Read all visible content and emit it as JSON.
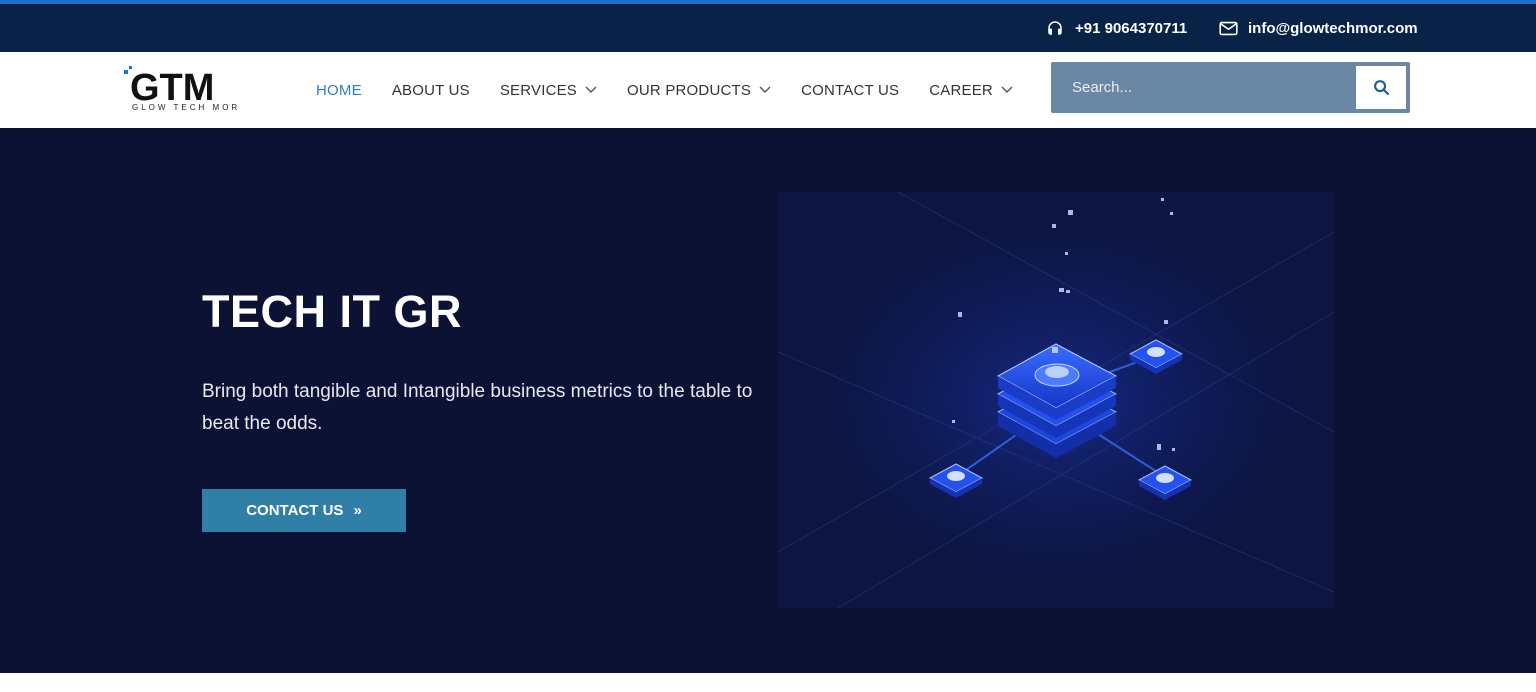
{
  "topbar": {
    "phone": "+91 9064370711",
    "email": "info@glowtechmor.com",
    "phone_icon": "headphones-icon",
    "email_icon": "envelope-icon"
  },
  "logo": {
    "mark": "GTM",
    "tagline": "GLOW TECH MOR"
  },
  "nav": {
    "items": [
      {
        "label": "HOME",
        "active": true,
        "dropdown": false
      },
      {
        "label": "ABOUT US",
        "active": false,
        "dropdown": false
      },
      {
        "label": "SERVICES",
        "active": false,
        "dropdown": true
      },
      {
        "label": "OUR PRODUCTS",
        "active": false,
        "dropdown": true
      },
      {
        "label": "CONTACT US",
        "active": false,
        "dropdown": false
      },
      {
        "label": "CAREER",
        "active": false,
        "dropdown": true
      }
    ]
  },
  "search": {
    "placeholder": "Search...",
    "icon": "search-icon"
  },
  "hero": {
    "title": "TECH IT GR",
    "subtitle": "Bring both tangible and Intangible business metrics to the table to beat the odds.",
    "cta_label": "CONTACT US",
    "cta_icon": "double-chevron-right-icon"
  },
  "colors": {
    "topbar_bg": "#082347",
    "accent_strip": "#1e6fd0",
    "nav_active": "#2b7fc1",
    "search_bg": "#6a88a4",
    "hero_bg": "#0b1233",
    "cta_bg": "#2f7fa6"
  }
}
